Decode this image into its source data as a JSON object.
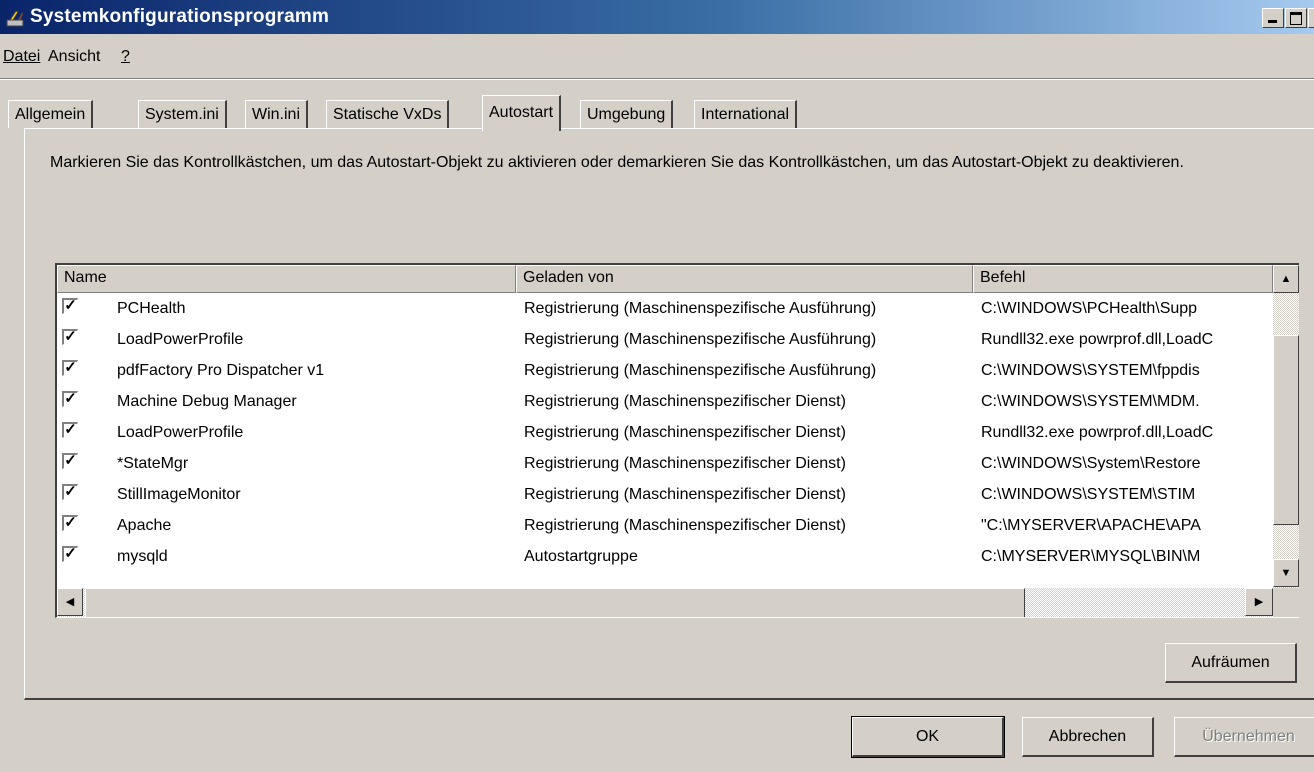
{
  "window": {
    "title": "Systemkonfigurationsprogramm"
  },
  "menu": {
    "datei": "Datei",
    "ansicht": "Ansicht",
    "help": "?"
  },
  "tabs": [
    "Allgemein",
    "System.ini",
    "Win.ini",
    "Statische VxDs",
    "Autostart",
    "Umgebung",
    "International"
  ],
  "active_tab": "Autostart",
  "description": "Markieren Sie das Kontrollkästchen, um das Autostart-Objekt zu aktivieren oder demarkieren Sie das Kontrollkästchen, um das Autostart-Objekt zu deaktivieren.",
  "list": {
    "columns": {
      "name": "Name",
      "geladen": "Geladen von",
      "befehl": "Befehl"
    },
    "rows": [
      {
        "checked": true,
        "name": "PCHealth",
        "geladen": "Registrierung (Maschinenspezifische Ausführung)",
        "befehl": "C:\\WINDOWS\\PCHealth\\Supp"
      },
      {
        "checked": true,
        "name": "LoadPowerProfile",
        "geladen": "Registrierung (Maschinenspezifische Ausführung)",
        "befehl": "Rundll32.exe powrprof.dll,LoadC"
      },
      {
        "checked": true,
        "name": "pdfFactory Pro Dispatcher v1",
        "geladen": "Registrierung (Maschinenspezifische Ausführung)",
        "befehl": "C:\\WINDOWS\\SYSTEM\\fppdis"
      },
      {
        "checked": true,
        "name": "Machine Debug Manager",
        "geladen": "Registrierung (Maschinenspezifischer Dienst)",
        "befehl": "C:\\WINDOWS\\SYSTEM\\MDM."
      },
      {
        "checked": true,
        "name": "LoadPowerProfile",
        "geladen": "Registrierung (Maschinenspezifischer Dienst)",
        "befehl": "Rundll32.exe powrprof.dll,LoadC"
      },
      {
        "checked": true,
        "name": "*StateMgr",
        "geladen": "Registrierung (Maschinenspezifischer Dienst)",
        "befehl": "C:\\WINDOWS\\System\\Restore"
      },
      {
        "checked": true,
        "name": "StillImageMonitor",
        "geladen": "Registrierung (Maschinenspezifischer Dienst)",
        "befehl": "C:\\WINDOWS\\SYSTEM\\STIM"
      },
      {
        "checked": true,
        "name": "Apache",
        "geladen": "Registrierung (Maschinenspezifischer Dienst)",
        "befehl": "\"C:\\MYSERVER\\APACHE\\APA"
      },
      {
        "checked": true,
        "name": "mysqld",
        "geladen": "Autostartgruppe",
        "befehl": "C:\\MYSERVER\\MYSQL\\BIN\\M"
      }
    ]
  },
  "buttons": {
    "aufraeumen": "Aufräumen",
    "ok": "OK",
    "abbrechen": "Abbrechen",
    "uebernehmen": "Übernehmen"
  }
}
